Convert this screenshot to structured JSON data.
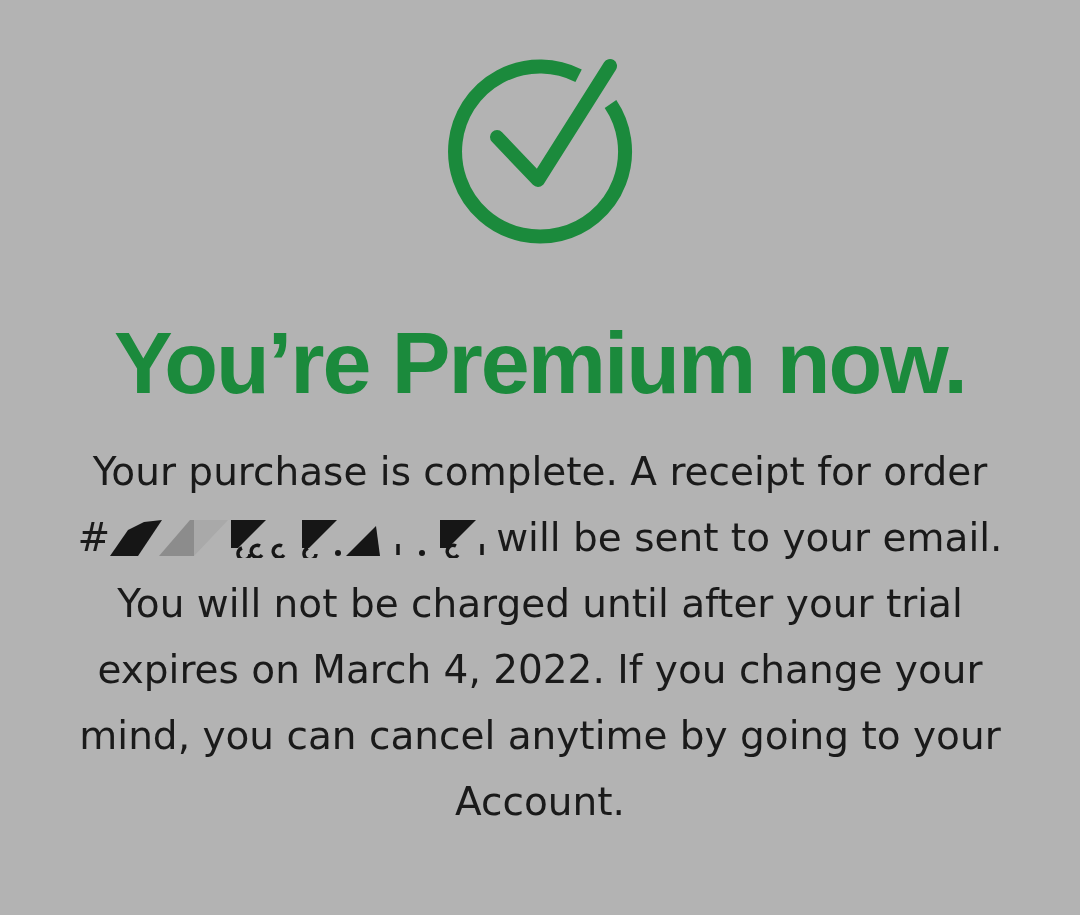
{
  "title": "You’re Premium now.",
  "message": {
    "receipt_start": "Your purchase is complete. A receipt for order",
    "order_number": "#",
    "order_number_redacted": true,
    "receipt_end": "will be sent to your email.",
    "trial_note": "You will not be charged until after your trial expires on March 4, 2022. If you change your mind, you can cancel anytime by going to your Account."
  }
}
